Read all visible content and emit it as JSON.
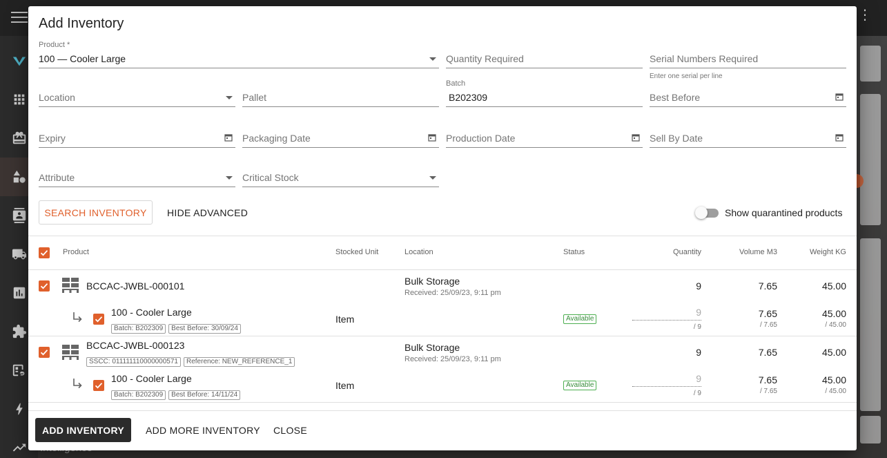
{
  "background": {
    "side_icons": [
      "apps-icon",
      "gift-icon",
      "shapes-icon",
      "contacts-icon",
      "truck-icon",
      "bar-chart-icon",
      "puzzle-icon",
      "badge-link-icon",
      "bolt-icon",
      "trending-icon"
    ],
    "sidebar_partial_label": "Intelligence"
  },
  "dialog": {
    "title": "Add Inventory",
    "fields": {
      "product": {
        "label": "Product *",
        "value": "100 — Cooler Large"
      },
      "quantity_required": {
        "placeholder": "Quantity Required"
      },
      "serial_numbers": {
        "placeholder": "Serial Numbers Required",
        "hint": "Enter one serial per line"
      },
      "location": {
        "placeholder": "Location"
      },
      "pallet": {
        "placeholder": "Pallet"
      },
      "batch": {
        "label": "Batch",
        "value": "B202309"
      },
      "best_before": {
        "placeholder": "Best Before"
      },
      "expiry": {
        "placeholder": "Expiry"
      },
      "packaging_date": {
        "placeholder": "Packaging Date"
      },
      "production_date": {
        "placeholder": "Production Date"
      },
      "sell_by_date": {
        "placeholder": "Sell By Date"
      },
      "attribute": {
        "placeholder": "Attribute"
      },
      "critical_stock": {
        "placeholder": "Critical Stock"
      }
    },
    "search_button": "SEARCH INVENTORY",
    "hide_advanced_button": "HIDE ADVANCED",
    "quarantine_toggle": {
      "label": "Show quarantined products",
      "on": false
    },
    "table": {
      "headers": {
        "product": "Product",
        "stocked_unit": "Stocked Unit",
        "location": "Location",
        "status": "Status",
        "quantity": "Quantity",
        "volume": "Volume M3",
        "weight": "Weight KG"
      },
      "groups": [
        {
          "pallet": {
            "code": "BCCAC-JWBL-000101",
            "tags": [],
            "location": "Bulk Storage",
            "received": "Received: 25/09/23, 9:11 pm",
            "quantity": "9",
            "volume": "7.65",
            "weight": "45.00",
            "checked": true
          },
          "item": {
            "name": "100 - Cooler Large",
            "tags": [
              "Batch: B202309",
              "Best Before: 30/09/24"
            ],
            "stocked_unit": "Item",
            "status": "Available",
            "quantity": "9",
            "quantity_total": "/ 9",
            "volume": "7.65",
            "volume_total": "/ 7.65",
            "weight": "45.00",
            "weight_total": "/ 45.00",
            "checked": true
          }
        },
        {
          "pallet": {
            "code": "BCCAC-JWBL-000123",
            "tags": [
              "SSCC: 011111110000000571",
              "Reference: NEW_REFERENCE_1"
            ],
            "location": "Bulk Storage",
            "received": "Received: 25/09/23, 9:11 pm",
            "quantity": "9",
            "volume": "7.65",
            "weight": "45.00",
            "checked": true
          },
          "item": {
            "name": "100 - Cooler Large",
            "tags": [
              "Batch: B202309",
              "Best Before: 14/11/24"
            ],
            "stocked_unit": "Item",
            "status": "Available",
            "quantity": "9",
            "quantity_total": "/ 9",
            "volume": "7.65",
            "volume_total": "/ 7.65",
            "weight": "45.00",
            "weight_total": "/ 45.00",
            "checked": true
          }
        }
      ]
    },
    "footer": {
      "add_inventory": "ADD INVENTORY",
      "add_more_inventory": "ADD MORE INVENTORY",
      "close": "CLOSE"
    },
    "colors": {
      "accent": "#e0602c",
      "available": "#388e3c"
    }
  }
}
